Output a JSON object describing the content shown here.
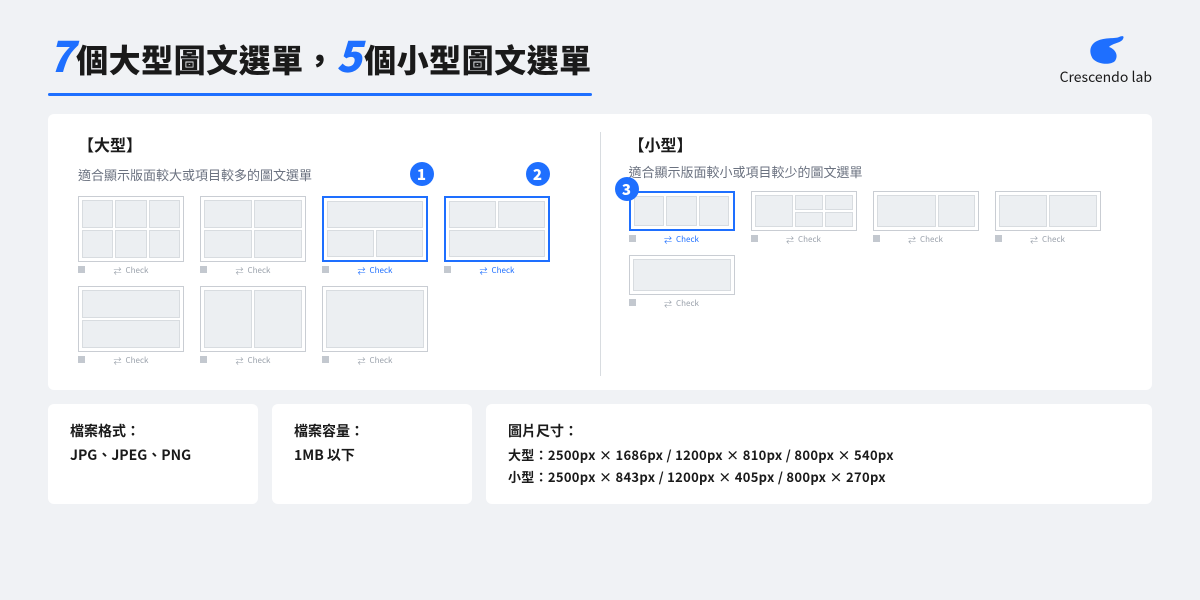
{
  "brand": "Crescendo lab",
  "title": {
    "num1": "7",
    "part1": "個大型圖文選單，",
    "num2": "5",
    "part2": "個小型圖文選單"
  },
  "panel": {
    "large": {
      "heading": "【大型】",
      "desc": "適合顯示版面較大或項目較多的圖文選單",
      "badge1": "1",
      "badge2": "2"
    },
    "small": {
      "heading": "【小型】",
      "desc": "適合顯示版面較小或項目較少的圖文選單",
      "badge3": "3"
    },
    "check_label": "Check"
  },
  "info": {
    "format_label": "檔案格式：",
    "format_value": "JPG、JPEG、PNG",
    "size_label": "檔案容量：",
    "size_value": "1MB 以下",
    "dim_label": "圖片尺寸：",
    "dim_large": "大型：2500px × 1686px  /  1200px × 810px  /  800px × 540px",
    "dim_small": "小型：2500px × 843px  /  1200px × 405px  /  800px × 270px"
  }
}
